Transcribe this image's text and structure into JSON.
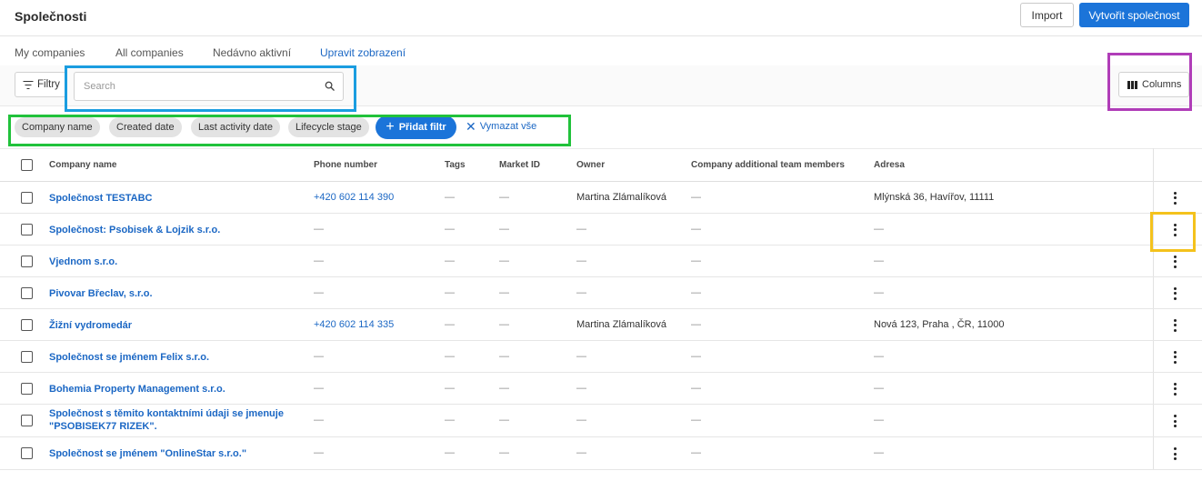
{
  "header": {
    "title": "Společnosti",
    "import_label": "Import",
    "create_label": "Vytvořit společnost"
  },
  "tabs": [
    {
      "label": "My companies"
    },
    {
      "label": "All companies"
    },
    {
      "label": "Nedávno aktivní"
    },
    {
      "label": "Upravit zobrazení"
    }
  ],
  "toolbar": {
    "filters_label": "Filtry",
    "search_placeholder": "Search",
    "search_value": "",
    "columns_label": "Columns"
  },
  "filter_chips": [
    {
      "label": "Company name"
    },
    {
      "label": "Created date"
    },
    {
      "label": "Last activity date"
    },
    {
      "label": "Lifecycle stage"
    }
  ],
  "add_filter_label": "Přidat filtr",
  "clear_all_label": "Vymazat vše",
  "table": {
    "columns": [
      "Company name",
      "Phone number",
      "Tags",
      "Market ID",
      "Owner",
      "Company additional team members",
      "Adresa"
    ],
    "rows": [
      {
        "name": "Společnost TESTABC",
        "phone": "+420 602 114 390",
        "tags": "—",
        "market_id": "—",
        "owner": "Martina Zlámalíková",
        "team": "—",
        "address": "Mlýnská 36, Havířov, 11111"
      },
      {
        "name": "Společnost: Psobisek & Lojzik s.r.o.",
        "phone": "—",
        "tags": "—",
        "market_id": "—",
        "owner": "—",
        "team": "—",
        "address": "—"
      },
      {
        "name": "Vjednom s.r.o.",
        "phone": "—",
        "tags": "—",
        "market_id": "—",
        "owner": "—",
        "team": "—",
        "address": "—"
      },
      {
        "name": "Pivovar Břeclav, s.r.o.",
        "phone": "—",
        "tags": "—",
        "market_id": "—",
        "owner": "—",
        "team": "—",
        "address": "—"
      },
      {
        "name": "Žižní vydromedár",
        "phone": "+420 602 114 335",
        "tags": "—",
        "market_id": "—",
        "owner": "Martina Zlámalíková",
        "team": "—",
        "address": "Nová 123, Praha , ČR, 11000"
      },
      {
        "name": "Společnost se jménem Felix s.r.o.",
        "phone": "—",
        "tags": "—",
        "market_id": "—",
        "owner": "—",
        "team": "—",
        "address": "—"
      },
      {
        "name": "Bohemia Property Management s.r.o.",
        "phone": "—",
        "tags": "—",
        "market_id": "—",
        "owner": "—",
        "team": "—",
        "address": "—"
      },
      {
        "name": "Společnost s těmito kontaktními údaji se jmenuje \"PSOBISEK77 RIZEK\".",
        "phone": "—",
        "tags": "—",
        "market_id": "—",
        "owner": "—",
        "team": "—",
        "address": "—"
      },
      {
        "name": "Společnost se jménem \"OnlineStar s.r.o.\"",
        "phone": "—",
        "tags": "—",
        "market_id": "—",
        "owner": "—",
        "team": "—",
        "address": "—"
      }
    ]
  },
  "icons": {
    "filter": "filter-icon",
    "search": "search-icon",
    "columns": "columns-icon",
    "add": "plus-icon",
    "clear": "x-icon",
    "row_actions": "kebab-menu-icon"
  },
  "colors": {
    "primary": "#1b74d9",
    "link": "#1b67c4",
    "highlight_search": "#1a9de0",
    "highlight_columns": "#b03db8",
    "highlight_chips": "#21c23b",
    "highlight_row_action": "#f4c21c"
  }
}
